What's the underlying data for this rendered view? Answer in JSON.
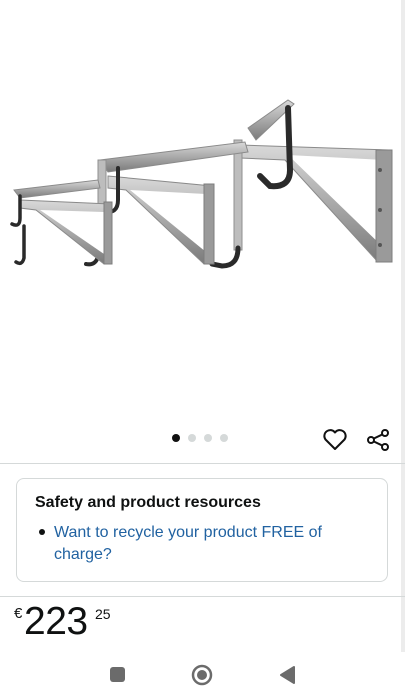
{
  "gallery": {
    "image_alt": "Wall-mounted folding bike hooks",
    "dot_count": 4,
    "active_index": 0
  },
  "icons": {
    "favorite": "heart-icon",
    "share": "share-icon"
  },
  "safety_card": {
    "title": "Safety and product resources",
    "link_text": "Want to recycle your product FREE of charge?"
  },
  "price": {
    "currency": "€",
    "whole": "223",
    "fraction": "25"
  },
  "system_nav": {
    "recents": "square-icon",
    "home": "home-circle-icon",
    "back": "back-triangle-icon"
  },
  "colors": {
    "link": "#2162a1",
    "text": "#0f1111",
    "border": "#d5d9d9"
  }
}
